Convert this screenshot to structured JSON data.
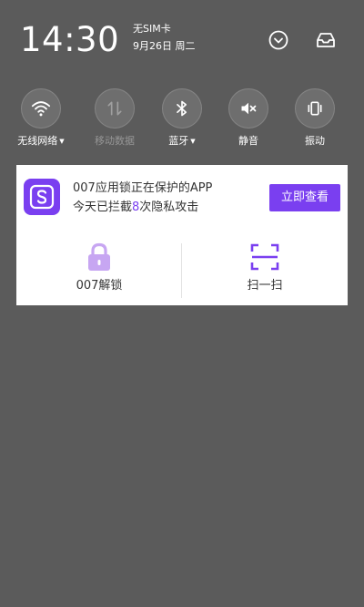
{
  "status": {
    "time": "14:30",
    "sim": "无SIM卡",
    "date": "9月26日 周二"
  },
  "header_icons": {
    "expand": "chevron-down-circle-icon",
    "inbox": "inbox-tray-icon"
  },
  "toggles": [
    {
      "label": "无线网络",
      "icon": "wifi-icon",
      "has_dropdown": true,
      "enabled": true
    },
    {
      "label": "移动数据",
      "icon": "mobile-data-icon",
      "has_dropdown": false,
      "enabled": false
    },
    {
      "label": "蓝牙",
      "icon": "bluetooth-icon",
      "has_dropdown": true,
      "enabled": true
    },
    {
      "label": "静音",
      "icon": "speaker-mute-icon",
      "has_dropdown": false,
      "enabled": true
    },
    {
      "label": "振动",
      "icon": "vibrate-icon",
      "has_dropdown": false,
      "enabled": true
    }
  ],
  "notification": {
    "line1": "007应用锁正在保护的APP",
    "line2_prefix": "今天已拦截",
    "line2_count": "8",
    "line2_suffix": "次隐私攻击",
    "view_button": "立即查看",
    "actions": [
      {
        "label": "007解锁",
        "icon": "lock-icon"
      },
      {
        "label": "扫一扫",
        "icon": "scan-icon"
      }
    ]
  },
  "colors": {
    "accent": "#7a3ff0",
    "background": "#5b5b5b",
    "card": "#ffffff"
  }
}
